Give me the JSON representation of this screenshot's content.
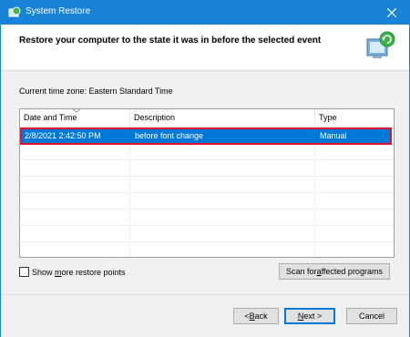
{
  "window": {
    "title": "System Restore"
  },
  "header": {
    "title": "Restore your computer to the state it was in before the selected event"
  },
  "timezone": "Current time zone: Eastern Standard Time",
  "table": {
    "columns": [
      "Date and Time",
      "Description",
      "Type"
    ],
    "rows": [
      {
        "date": "2/8/2021 2:42:50 PM",
        "description": "before font change",
        "type": "Manual",
        "selected": true
      }
    ]
  },
  "options": {
    "show_more_label_pre": "Show ",
    "show_more_label_accel": "m",
    "show_more_label_post": "ore restore points",
    "checked": false
  },
  "buttons": {
    "scan_pre": "Scan for ",
    "scan_accel": "a",
    "scan_post": "ffected programs",
    "back_pre": "< ",
    "back_accel": "B",
    "back_post": "ack",
    "next_accel": "N",
    "next_post": "ext >",
    "cancel": "Cancel"
  },
  "colors": {
    "titlebar": "#1883d7",
    "selection": "#0078d7",
    "highlight_border": "#e0142e"
  },
  "icons": {
    "title": "system-restore-icon",
    "header": "restore-computer-icon",
    "close": "close-icon"
  }
}
